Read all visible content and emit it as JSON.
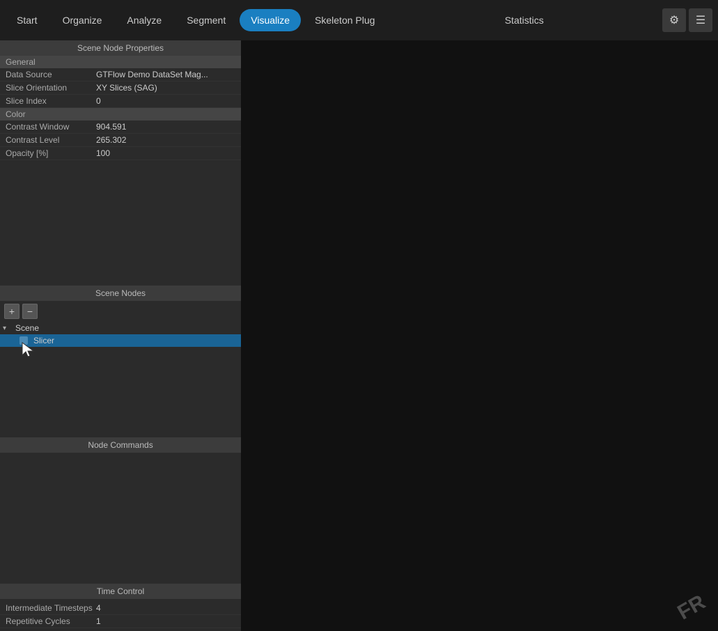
{
  "nav": {
    "items": [
      {
        "label": "Start",
        "active": false
      },
      {
        "label": "Organize",
        "active": false
      },
      {
        "label": "Analyze",
        "active": false
      },
      {
        "label": "Segment",
        "active": false
      },
      {
        "label": "Visualize",
        "active": true
      },
      {
        "label": "Skeleton Plug",
        "active": false
      },
      {
        "label": "Statistics",
        "active": false
      }
    ],
    "icon_settings": "⚙",
    "icon_menu": "☰"
  },
  "scene_node_properties": {
    "header": "Scene Node Properties",
    "groups": [
      {
        "name": "General",
        "rows": [
          {
            "label": "Data Source",
            "value": "GTFlow Demo DataSet Mag..."
          },
          {
            "label": "Slice Orientation",
            "value": "XY Slices (SAG)"
          },
          {
            "label": "Slice Index",
            "value": "0"
          }
        ]
      },
      {
        "name": "Color",
        "rows": [
          {
            "label": "Contrast Window",
            "value": "904.591"
          },
          {
            "label": "Contrast Level",
            "value": "265.302"
          },
          {
            "label": "Opacity [%]",
            "value": "100"
          }
        ]
      }
    ]
  },
  "scene_nodes": {
    "header": "Scene Nodes",
    "add_btn": "+",
    "remove_btn": "−",
    "tree": [
      {
        "label": "Scene",
        "depth": 0,
        "arrow": "▾",
        "selected": false
      },
      {
        "label": "Slicer",
        "depth": 1,
        "arrow": "",
        "selected": true
      }
    ]
  },
  "node_commands": {
    "header": "Node Commands"
  },
  "time_control": {
    "header": "Time Control",
    "rows": [
      {
        "label": "Intermediate Timesteps",
        "value": "4"
      },
      {
        "label": "Repetitive Cycles",
        "value": "1"
      }
    ]
  }
}
